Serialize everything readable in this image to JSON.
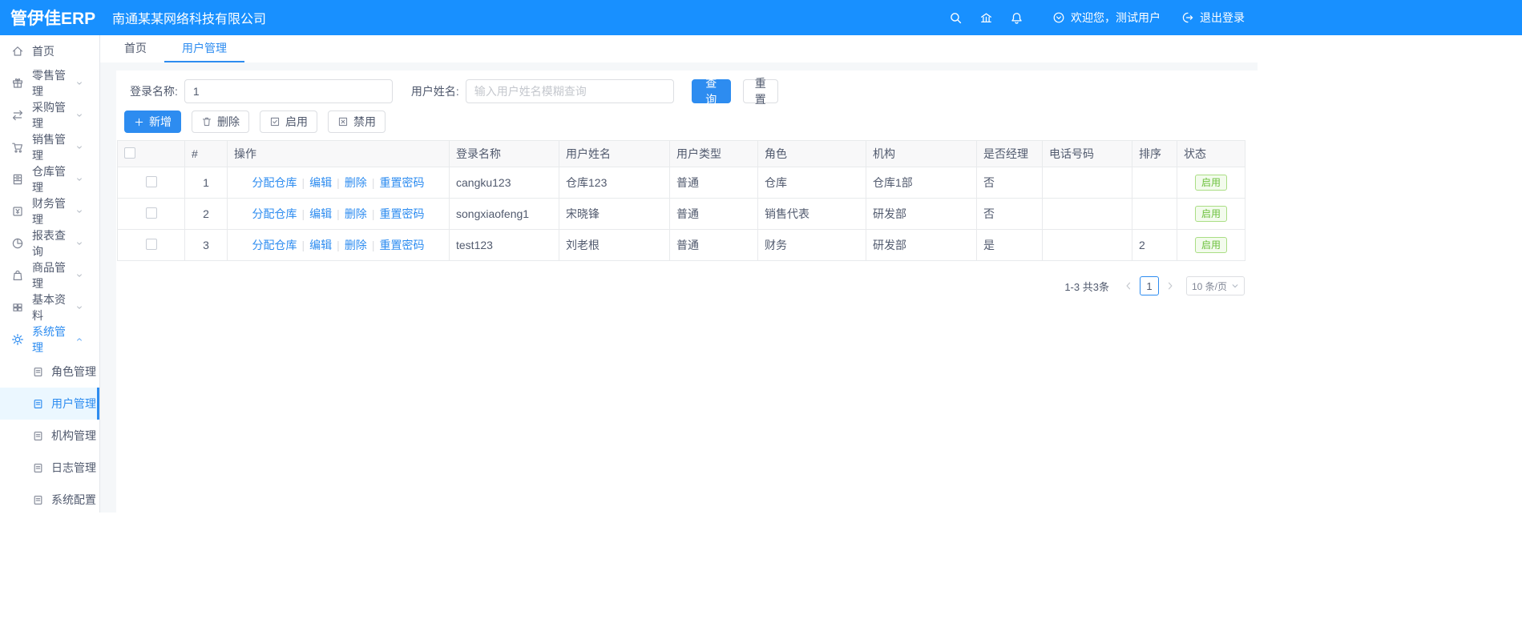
{
  "topbar": {
    "logo": "管伊佳ERP",
    "company": "南通某某网络科技有限公司",
    "welcome": "欢迎您，测试用户",
    "logout": "退出登录"
  },
  "sidebar": {
    "items": [
      {
        "name": "home",
        "label": "首页",
        "icon": "home-icon",
        "expandable": false
      },
      {
        "name": "retail",
        "label": "零售管理",
        "icon": "gift-icon",
        "expandable": true
      },
      {
        "name": "purchase",
        "label": "采购管理",
        "icon": "swap-icon",
        "expandable": true
      },
      {
        "name": "sales",
        "label": "销售管理",
        "icon": "cart-icon",
        "expandable": true
      },
      {
        "name": "warehouse",
        "label": "仓库管理",
        "icon": "cabinet-icon",
        "expandable": true
      },
      {
        "name": "finance",
        "label": "财务管理",
        "icon": "finance-icon",
        "expandable": true
      },
      {
        "name": "report",
        "label": "报表查询",
        "icon": "piechart-icon",
        "expandable": true
      },
      {
        "name": "goods",
        "label": "商品管理",
        "icon": "bag-icon",
        "expandable": true
      },
      {
        "name": "basic-data",
        "label": "基本资料",
        "icon": "grid-icon",
        "expandable": true
      },
      {
        "name": "system",
        "label": "系统管理",
        "icon": "gear-icon",
        "expandable": true,
        "expanded": true,
        "active": true,
        "children": [
          {
            "name": "role-management",
            "label": "角色管理"
          },
          {
            "name": "user-management",
            "label": "用户管理",
            "active": true
          },
          {
            "name": "org-management",
            "label": "机构管理"
          },
          {
            "name": "log-management",
            "label": "日志管理"
          },
          {
            "name": "system-config",
            "label": "系统配置"
          }
        ]
      }
    ]
  },
  "tabs": [
    {
      "label": "首页",
      "active": false
    },
    {
      "label": "用户管理",
      "active": true
    }
  ],
  "filters": {
    "login_name_label": "登录名称:",
    "login_name_value": "1",
    "user_name_label": "用户姓名:",
    "user_name_placeholder": "输入用户姓名模糊查询",
    "search_button": "查 询",
    "reset_button": "重 置"
  },
  "toolbar": {
    "buttons": [
      {
        "name": "add",
        "label": "新增",
        "icon": "plus-icon",
        "primary": true
      },
      {
        "name": "delete",
        "label": "删除",
        "icon": "trash-icon",
        "primary": false
      },
      {
        "name": "enable",
        "label": "启用",
        "icon": "check-square-icon",
        "primary": false
      },
      {
        "name": "disable",
        "label": "禁用",
        "icon": "x-square-icon",
        "primary": false
      }
    ]
  },
  "table": {
    "columns": [
      "#",
      "操作",
      "登录名称",
      "用户姓名",
      "用户类型",
      "角色",
      "机构",
      "是否经理",
      "电话号码",
      "排序",
      "状态"
    ],
    "row_actions": [
      "分配仓库",
      "编辑",
      "删除",
      "重置密码"
    ],
    "rows": [
      {
        "index": "1",
        "login_name": "cangku123",
        "user_name": "仓库123",
        "user_type": "普通",
        "role": "仓库",
        "org": "仓库1部",
        "is_manager": "否",
        "phone": "",
        "sort": "",
        "status": "启用"
      },
      {
        "index": "2",
        "login_name": "songxiaofeng1",
        "user_name": "宋晓锋",
        "user_type": "普通",
        "role": "销售代表",
        "org": "研发部",
        "is_manager": "否",
        "phone": "",
        "sort": "",
        "status": "启用"
      },
      {
        "index": "3",
        "login_name": "test123",
        "user_name": "刘老根",
        "user_type": "普通",
        "role": "财务",
        "org": "研发部",
        "is_manager": "是",
        "phone": "",
        "sort": "2",
        "status": "启用"
      }
    ]
  },
  "pagination": {
    "total_text": "1-3 共3条",
    "current_page": "1",
    "page_size": "10 条/页"
  },
  "colors": {
    "topbar_bg": "#1890ff",
    "primary": "#2d8cf0",
    "success_text": "#6cc13d",
    "success_border": "#aade84",
    "table_border": "#e8eaec"
  }
}
